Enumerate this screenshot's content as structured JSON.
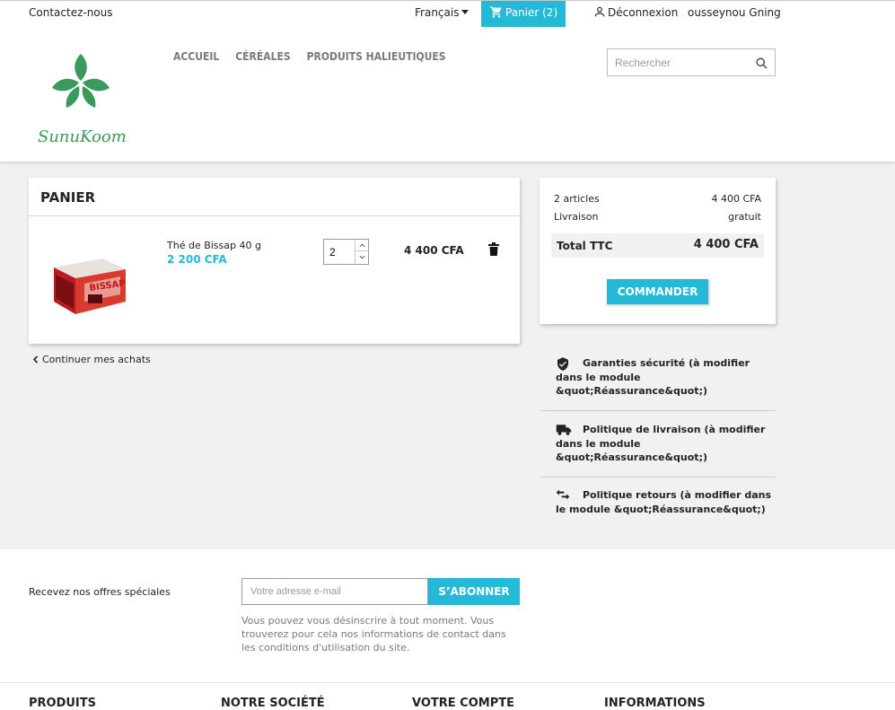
{
  "topnav": {
    "contact": "Contactez-nous",
    "language": "Français",
    "cart_label": "Panier (2)",
    "logout": "Déconnexion",
    "user": "ousseynou Gning"
  },
  "header": {
    "logo_alt": "SunuKoom",
    "menu": [
      "ACCUEIL",
      "CÉRÉALES",
      "PRODUITS HALIEUTIQUES"
    ],
    "search_placeholder": "Rechercher"
  },
  "cart": {
    "title": "PANIER",
    "items": [
      {
        "name": "Thé de Bissap 40 g",
        "unit_price": "2 200 CFA",
        "quantity": "2",
        "line_total": "4 400 CFA",
        "image_icon": "bissap-tea-box-image"
      }
    ],
    "continue_label": "Continuer mes achats"
  },
  "summary": {
    "articles_label": "2 articles",
    "articles_value": "4 400 CFA",
    "shipping_label": "Livraison",
    "shipping_value": "gratuit",
    "total_label": "Total TTC",
    "total_value": "4 400 CFA",
    "order_button": "COMMANDER"
  },
  "reassurance": [
    {
      "icon": "shield-check-icon",
      "text": "Garanties sécurité (à modifier dans le module &quot;Réassurance&quot;)"
    },
    {
      "icon": "truck-icon",
      "text": "Politique de livraison (à modifier dans le module &quot;Réassurance&quot;)"
    },
    {
      "icon": "swap-arrows-icon",
      "text": "Politique retours (à modifier dans le module &quot;Réassurance&quot;)"
    }
  ],
  "newsletter": {
    "label": "Recevez nos offres spéciales",
    "email_placeholder": "Votre adresse e-mail",
    "subscribe_button": "S’ABONNER",
    "note": "Vous pouvez vous désinscrire à tout moment. Vous trouverez pour cela nos informations de contact dans les conditions d'utilisation du site."
  },
  "footer": {
    "columns": [
      "PRODUITS",
      "NOTRE SOCIÉTÉ",
      "VOTRE COMPTE",
      "INFORMATIONS"
    ]
  },
  "colors": {
    "accent": "#24b9d7",
    "page_bg": "#f1f1f1",
    "logo_green": "#3a9a5b"
  }
}
